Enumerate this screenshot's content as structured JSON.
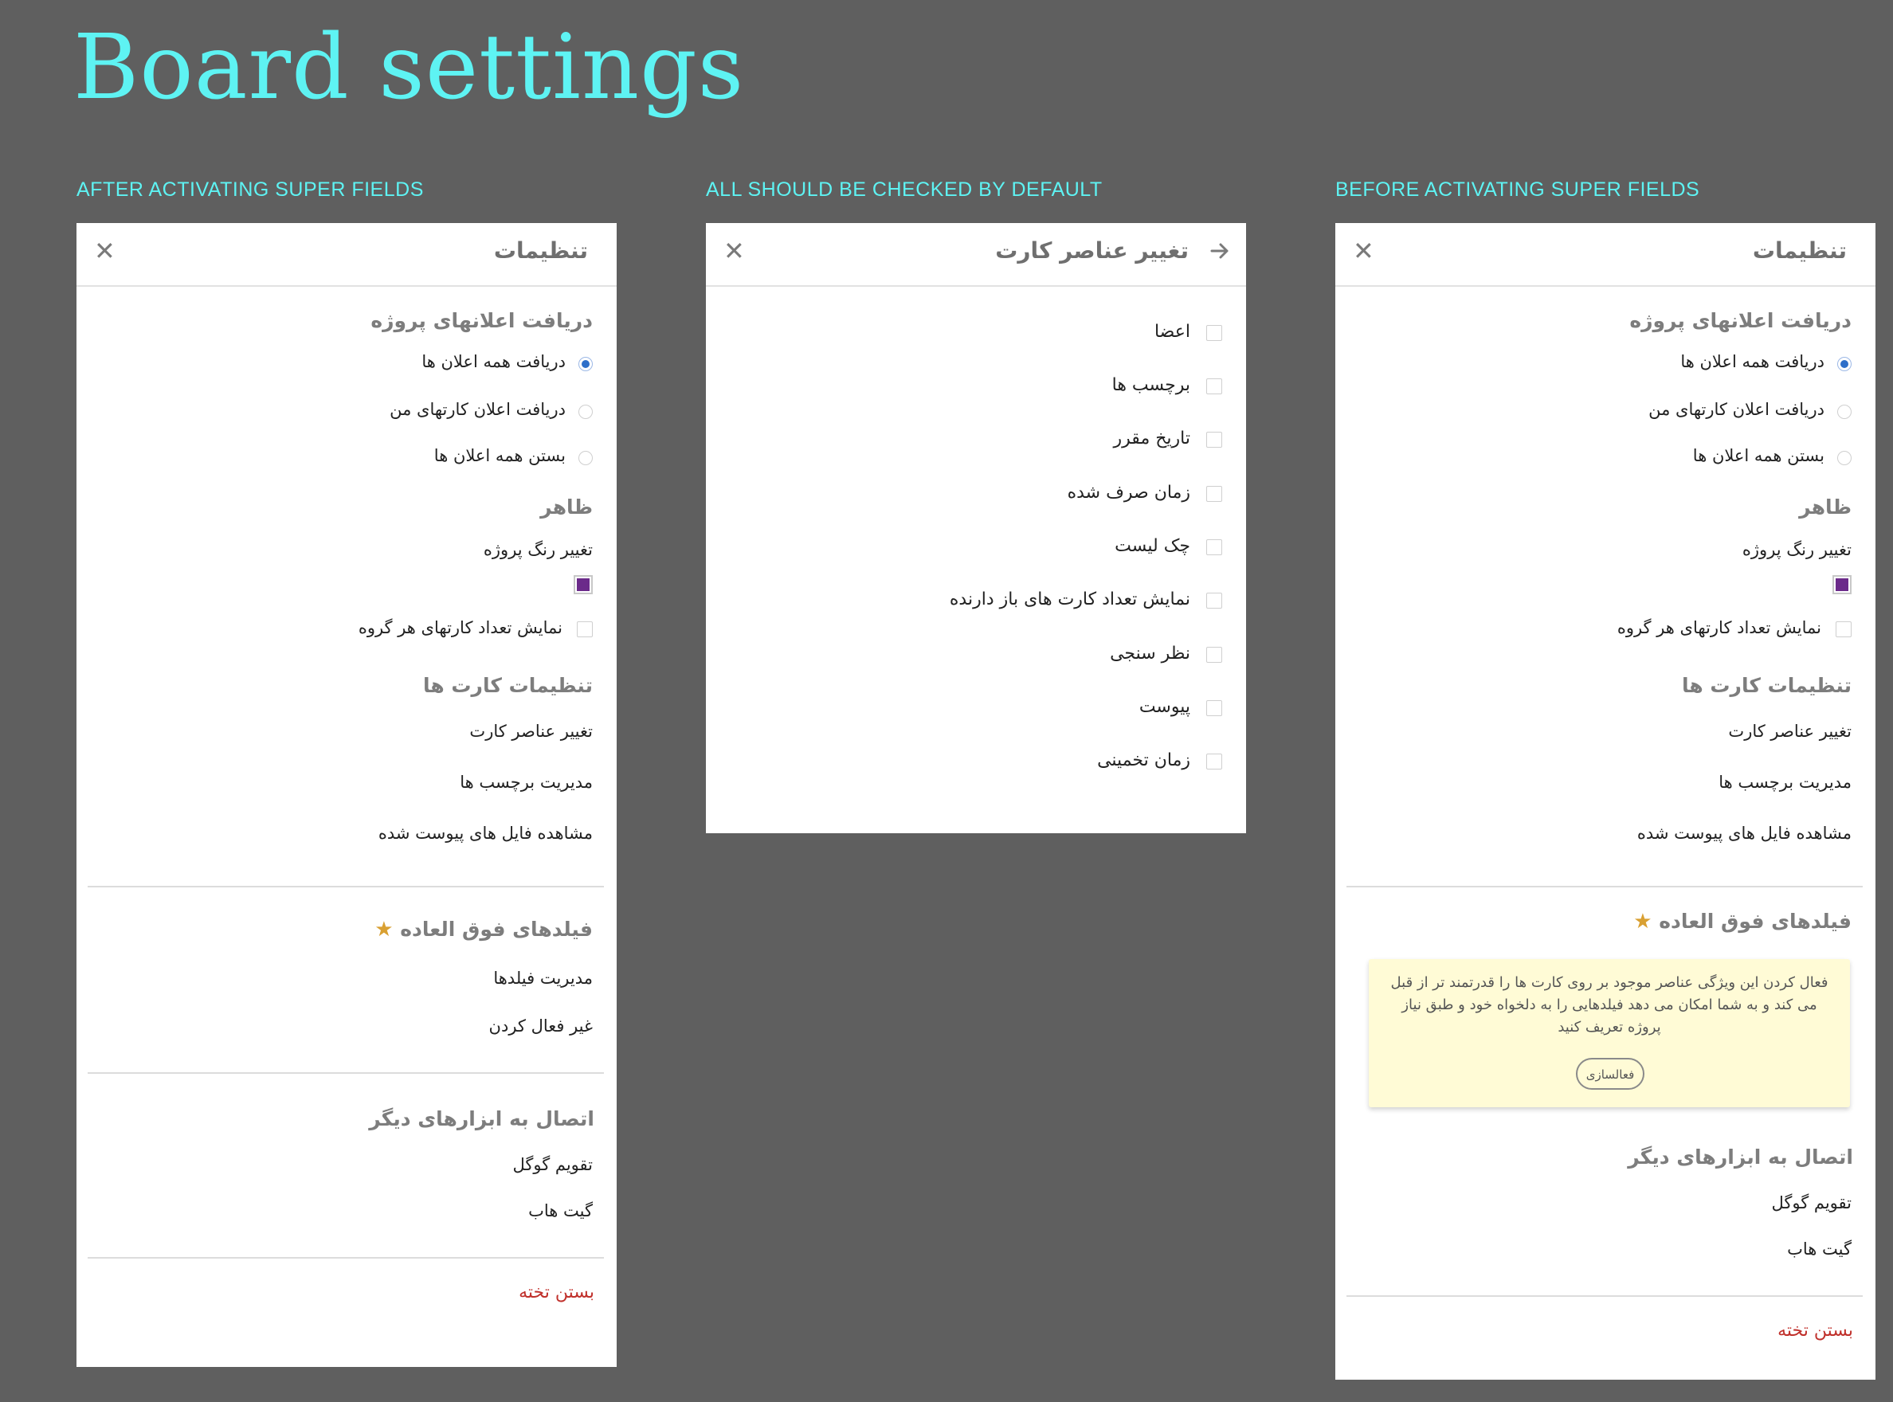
{
  "page": {
    "title": "Board settings"
  },
  "captions": {
    "left": "AFTER ACTIVATING SUPER FIELDS",
    "middle": "ALL SHOULD BE CHECKED BY DEFAULT",
    "right": "BEFORE ACTIVATING SUPER FIELDS"
  },
  "settings": {
    "title": "تنظیمات",
    "close_icon": "close-icon",
    "notifications": {
      "heading": "دریافت اعلانهای پروژه",
      "options": [
        "دریافت همه اعلان ها",
        "دریافت اعلان کارتهای من",
        "بستن همه اعلان ها"
      ],
      "selected": 0
    },
    "appearance": {
      "heading": "ظاهر",
      "change_color": "تغییر رنگ پروژه",
      "color": "#6b2a8a",
      "show_count": "نمایش تعداد کارتهای هر گروه"
    },
    "card_settings": {
      "heading": "تنظیمات کارت ها",
      "items": [
        "تغییر عناصر کارت",
        "مدیریت برچسب ها",
        "مشاهده فایل های پیوست شده"
      ]
    },
    "super_fields": {
      "heading": "فیلدهای فوق العاده",
      "star_icon": "star-icon",
      "after_items": [
        "مدیریت فیلدها",
        "غیر فعال کردن"
      ],
      "promo_text": "فعال کردن این ویژگی عناصر موجود بر روی کارت ها را قدرتمند تر از قبل می کند و به شما امکان می دهد فیلدهایی را به دلخواه خود و طبق نیاز پروژه تعریف کنید",
      "promo_button": "فعالسازی"
    },
    "integrations": {
      "heading": "اتصال به ابزارهای دیگر",
      "items": [
        "تقویم گوگل",
        "گیت هاب"
      ]
    },
    "close_board": "بستن تخته",
    "close_board_color": "#c0302b"
  },
  "card_elements": {
    "title": "تغییر عناصر کارت",
    "back_icon": "arrow-right-icon",
    "items": [
      "اعضا",
      "برچسب ها",
      "تاریخ مقرر",
      "زمان صرف شده",
      "چک لیست",
      "نمایش تعداد کارت های باز دارنده",
      "نظر سنجی",
      "پیوست",
      "زمان تخمینی"
    ]
  }
}
